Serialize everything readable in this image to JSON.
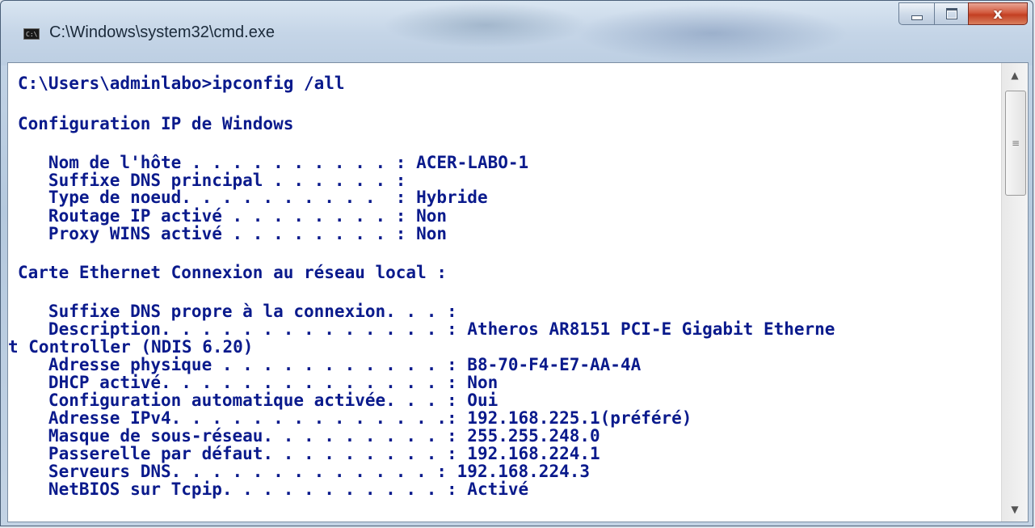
{
  "window": {
    "title": "C:\\Windows\\system32\\cmd.exe",
    "icon": "cmd-console-icon",
    "icon_text": "C:\\",
    "buttons": {
      "minimize": "minimize-icon",
      "maximize": "maximize-icon",
      "close": "close-icon",
      "close_glyph": "x"
    }
  },
  "scrollbar": {
    "up": "▲",
    "down": "▼",
    "grip": "≡"
  },
  "console": {
    "lines": [
      "C:\\Users\\adminlabo>ipconfig /all",
      "",
      "Configuration IP de Windows",
      "",
      "   Nom de l'hôte . . . . . . . . . . : ACER-LABO-1",
      "   Suffixe DNS principal . . . . . . :",
      "   Type de noeud. . . . . . . . . .  : Hybride",
      "   Routage IP activé . . . . . . . . : Non",
      "   Proxy WINS activé . . . . . . . . : Non",
      "",
      "Carte Ethernet Connexion au réseau local :",
      "",
      "   Suffixe DNS propre à la connexion. . . :",
      "   Description. . . . . . . . . . . . . . : Atheros AR8151 PCI-E Gigabit Etherne",
      "t Controller (NDIS 6.20)",
      "   Adresse physique . . . . . . . . . . . : B8-70-F4-E7-AA-4A",
      "   DHCP activé. . . . . . . . . . . . . . : Non",
      "   Configuration automatique activée. . . : Oui",
      "   Adresse IPv4. . . . . . . . . . . . . .: 192.168.225.1(préféré)",
      "   Masque de sous-réseau. . . . . . . . . : 255.255.248.0",
      "   Passerelle par défaut. . . . . . . . . : 192.168.224.1",
      "   Serveurs DNS. . . . . . . . . . . . . : 192.168.224.3",
      "   NetBIOS sur Tcpip. . . . . . . . . . . : Activé"
    ]
  },
  "colors": {
    "console_text": "#0a1a8c",
    "console_bg": "#ffffff",
    "close_button": "#c33f22"
  }
}
